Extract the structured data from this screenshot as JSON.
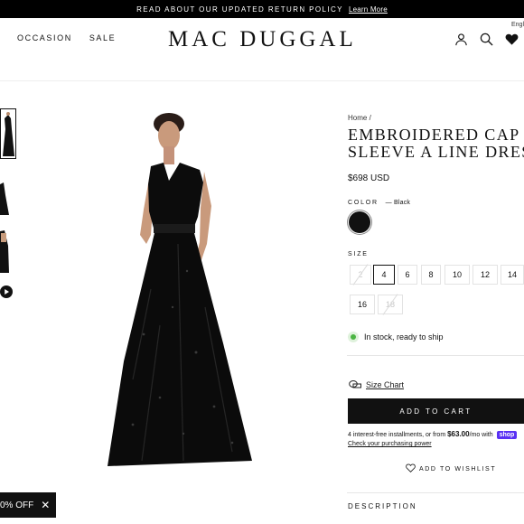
{
  "announcement": {
    "text": "READ ABOUT OUR UPDATED RETURN POLICY",
    "link": "Learn More"
  },
  "language": "Engl",
  "nav": {
    "items": [
      "OCCASION",
      "SALE"
    ]
  },
  "logo": "MAC DUGGAL",
  "header_icons": [
    "account-icon",
    "search-icon",
    "heart-icon"
  ],
  "product": {
    "breadcrumb": "Home /",
    "title_line1": "EMBROIDERED CAP",
    "title_line2": "SLEEVE A LINE DRESS",
    "price": "$698 USD",
    "color_label": "COLOR",
    "color_selected": "— Black",
    "size_label": "SIZE",
    "sizes": [
      {
        "label": "2",
        "state": "sold"
      },
      {
        "label": "4",
        "state": "active"
      },
      {
        "label": "6",
        "state": "available"
      },
      {
        "label": "8",
        "state": "available"
      },
      {
        "label": "10",
        "state": "available"
      },
      {
        "label": "12",
        "state": "available"
      },
      {
        "label": "14",
        "state": "available"
      },
      {
        "label": "16",
        "state": "available"
      },
      {
        "label": "18",
        "state": "sold"
      }
    ],
    "stock": "In stock, ready to ship",
    "size_chart": "Size Chart",
    "add_to_cart": "ADD TO CART",
    "installments_pre": "4 interest-free installments, or from ",
    "installments_amount": "$63.00",
    "installments_post": "/mo with",
    "shop_pay": "shop",
    "check_power": "Check your purchasing power",
    "wishlist": "ADD TO WISHLIST",
    "description": "DESCRIPTION"
  },
  "promo": {
    "text": "0% OFF",
    "close": "✕"
  },
  "colors": {
    "swatch": "#111111",
    "stock_dot": "#4bb543",
    "shop_pay": "#5a31f4"
  }
}
